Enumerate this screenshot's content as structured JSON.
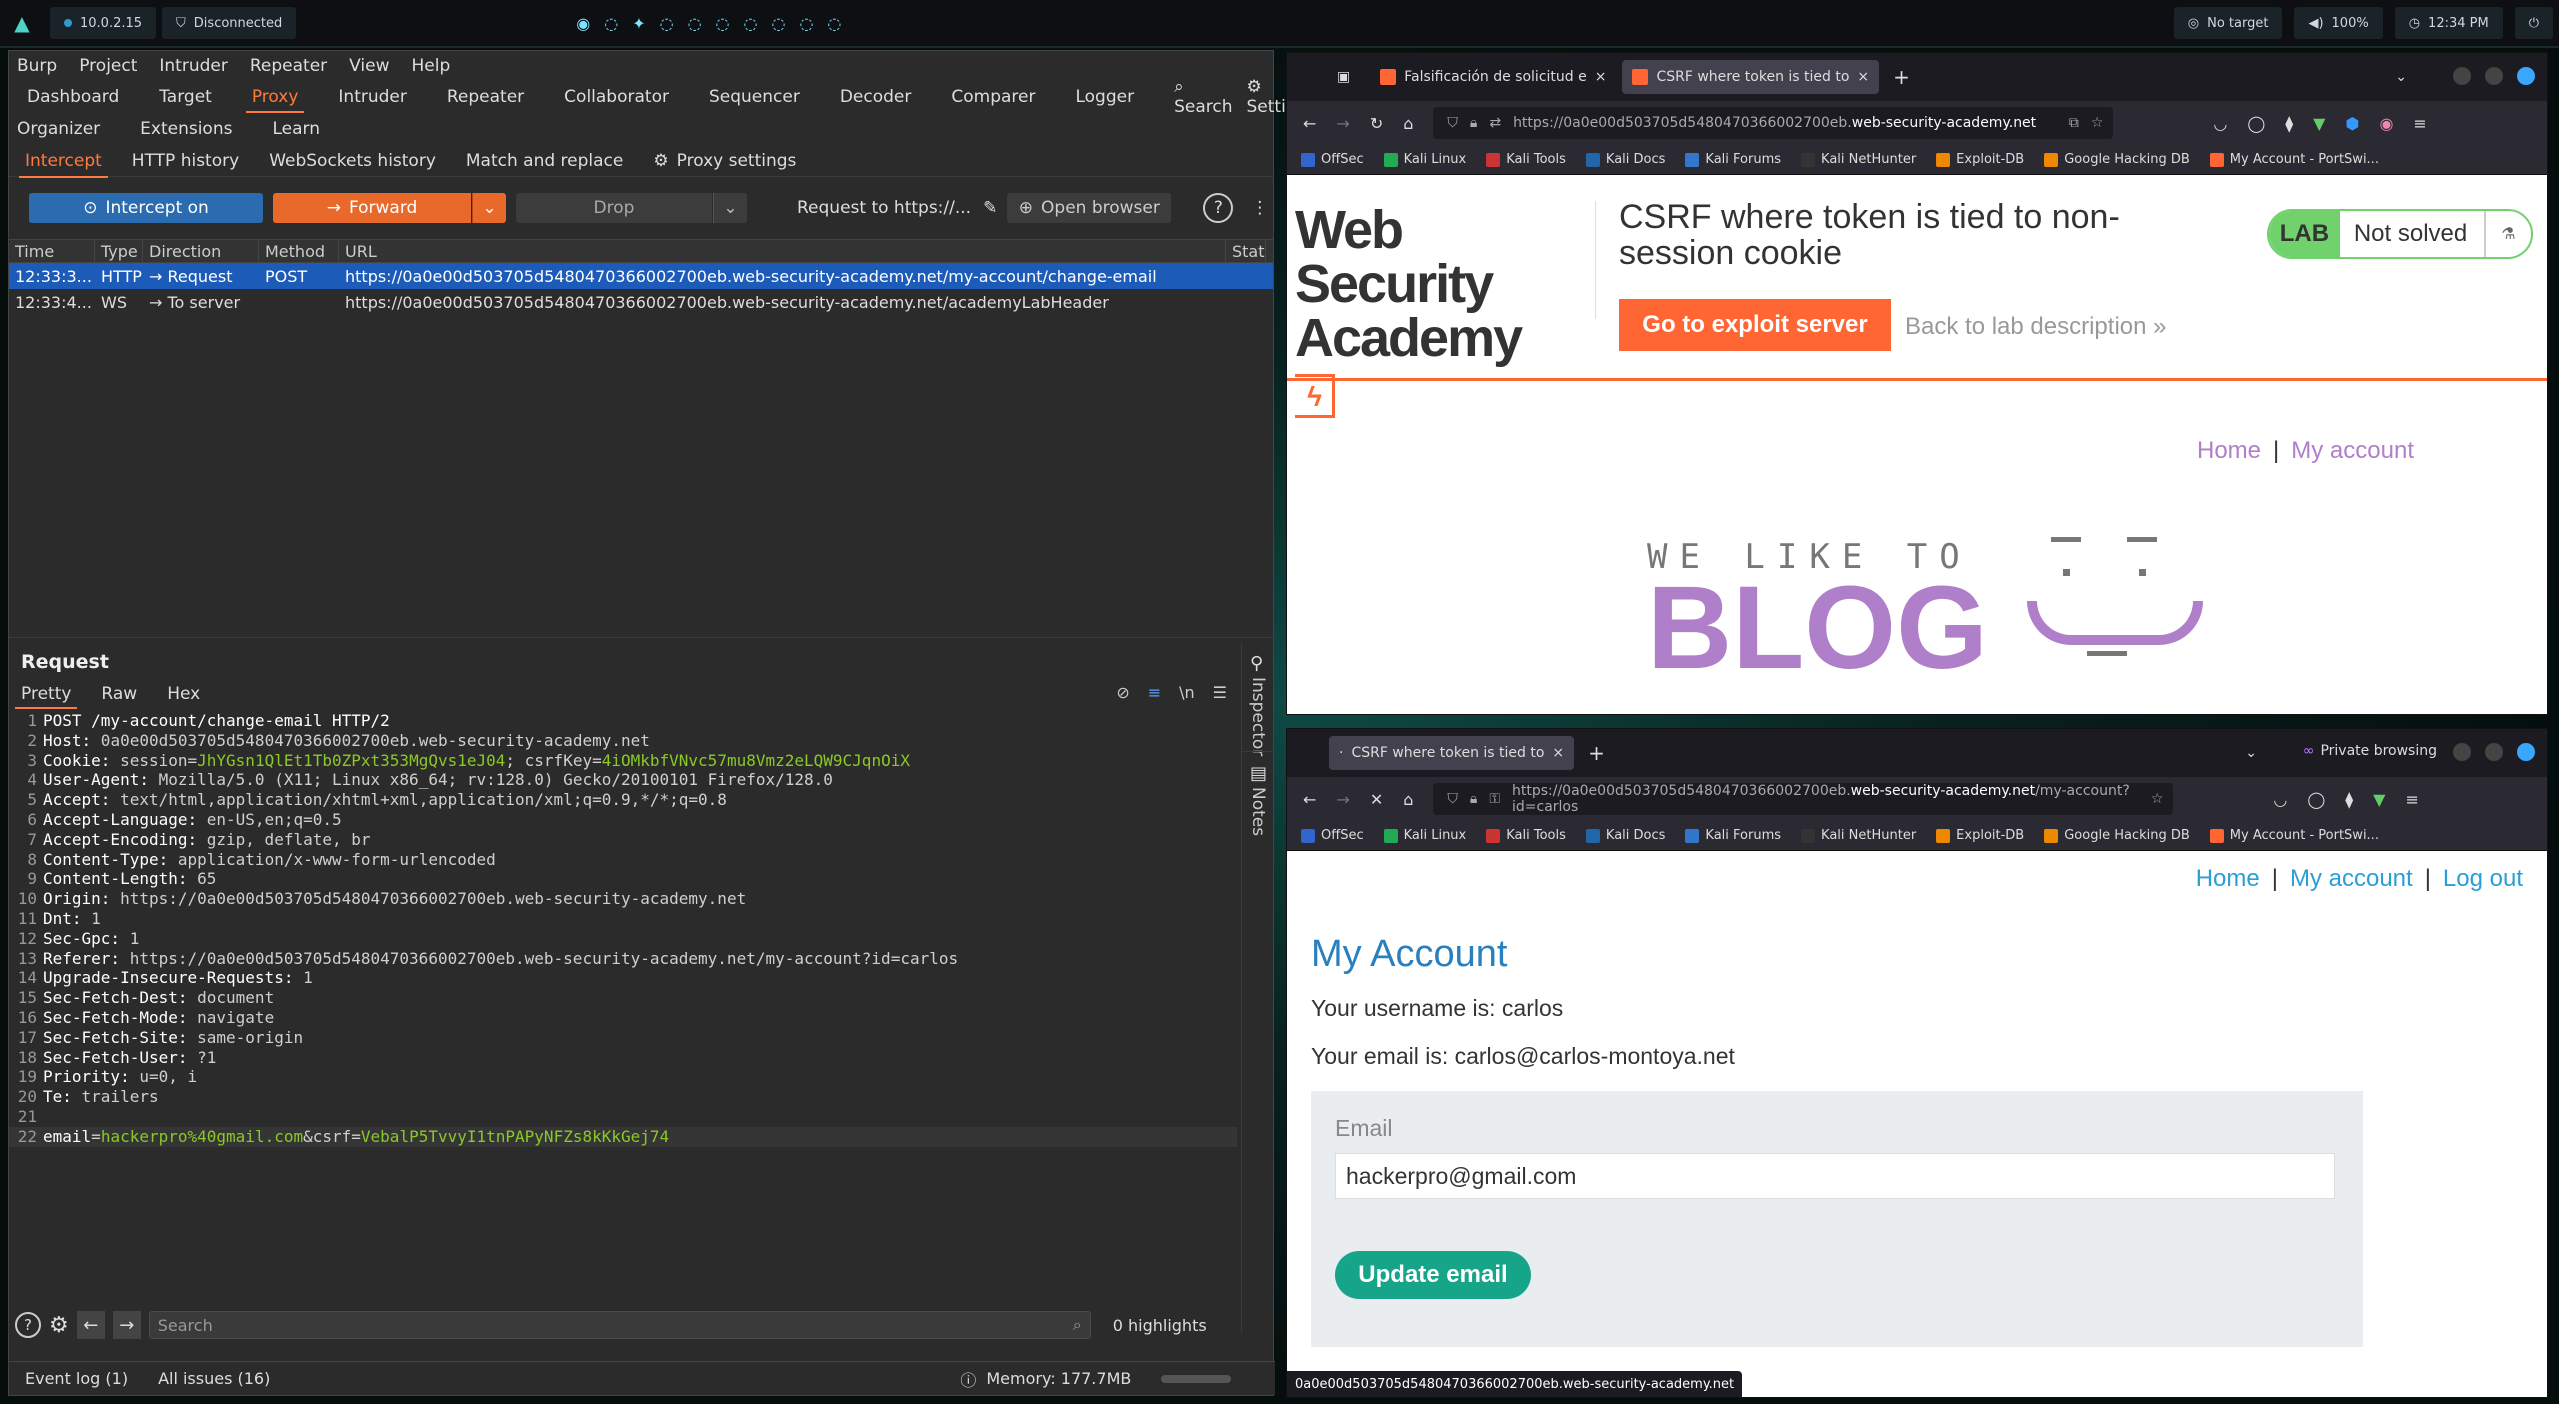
{
  "topbar": {
    "ip": "10.0.2.15",
    "vpn": "Disconnected",
    "target": "No target",
    "volume": "100%",
    "clock": "12:34 PM"
  },
  "burp": {
    "menu": [
      "Burp",
      "Project",
      "Intruder",
      "Repeater",
      "View",
      "Help"
    ],
    "tabs_row1": [
      "Dashboard",
      "Target",
      "Proxy",
      "Intruder",
      "Repeater",
      "Collaborator",
      "Sequencer",
      "Decoder",
      "Comparer",
      "Logger"
    ],
    "search_label": "Search",
    "settings_label": "Settings",
    "tabs_row2": [
      "Organizer",
      "Extensions",
      "Learn"
    ],
    "subtabs": [
      "Intercept",
      "HTTP history",
      "WebSockets history",
      "Match and replace"
    ],
    "proxy_settings": "Proxy settings",
    "intercept_btn": "Intercept on",
    "forward_btn": "Forward",
    "drop_btn": "Drop",
    "request_to": "Request to https://...",
    "open_browser": "Open browser",
    "columns": [
      "Time",
      "Type",
      "Direction",
      "Method",
      "URL",
      "Statu"
    ],
    "rows": [
      {
        "time": "12:33:3...",
        "type": "HTTP",
        "direction": "Request",
        "method": "POST",
        "url": "https://0a0e00d503705d5480470366002700eb.web-security-academy.net/my-account/change-email"
      },
      {
        "time": "12:33:4...",
        "type": "WS",
        "direction": "To server",
        "method": "",
        "url": "https://0a0e00d503705d5480470366002700eb.web-security-academy.net/academyLabHeader"
      }
    ],
    "request_title": "Request",
    "request_tabs": [
      "Pretty",
      "Raw",
      "Hex"
    ],
    "newline_toggle": "\\n",
    "request_lines": [
      {
        "k": "POST /my-account/change-email HTTP/2",
        "v": ""
      },
      {
        "k": "Host:",
        "v": " 0a0e00d503705d5480470366002700eb.web-security-academy.net"
      },
      {
        "k": "Cookie:",
        "v": " session=",
        "g": "JhYGsn1QlEt1Tb0ZPxt353MgQvs1eJ04",
        "v2": "; csrfKey=",
        "g2": "4iOMkbfVNvc57mu8Vmz2eLQW9CJqnOiX"
      },
      {
        "k": "User-Agent:",
        "v": " Mozilla/5.0 (X11; Linux x86_64; rv:128.0) Gecko/20100101 Firefox/128.0"
      },
      {
        "k": "Accept:",
        "v": " text/html,application/xhtml+xml,application/xml;q=0.9,*/*;q=0.8"
      },
      {
        "k": "Accept-Language:",
        "v": " en-US,en;q=0.5"
      },
      {
        "k": "Accept-Encoding:",
        "v": " gzip, deflate, br"
      },
      {
        "k": "Content-Type:",
        "v": " application/x-www-form-urlencoded"
      },
      {
        "k": "Content-Length:",
        "v": " 65"
      },
      {
        "k": "Origin:",
        "v": " https://0a0e00d503705d5480470366002700eb.web-security-academy.net"
      },
      {
        "k": "Dnt:",
        "v": " 1"
      },
      {
        "k": "Sec-Gpc:",
        "v": " 1"
      },
      {
        "k": "Referer:",
        "v": " https://0a0e00d503705d5480470366002700eb.web-security-academy.net/my-account?id=carlos"
      },
      {
        "k": "Upgrade-Insecure-Requests:",
        "v": " 1"
      },
      {
        "k": "Sec-Fetch-Dest:",
        "v": " document"
      },
      {
        "k": "Sec-Fetch-Mode:",
        "v": " navigate"
      },
      {
        "k": "Sec-Fetch-Site:",
        "v": " same-origin"
      },
      {
        "k": "Sec-Fetch-User:",
        "v": " ?1"
      },
      {
        "k": "Priority:",
        "v": " u=0, i"
      },
      {
        "k": "Te:",
        "v": " trailers"
      },
      {
        "k": "",
        "v": ""
      },
      {
        "k": "email",
        "v": "=",
        "g": "hackerpro%40gmail.com",
        "v2": "&csrf=",
        "g2": "VebalP5TvvyI1tnPAPyNFZs8kKkGej74"
      }
    ],
    "inspector_label": "Inspector",
    "notes_label": "Notes",
    "search_placeholder": "Search",
    "highlights": "0 highlights",
    "event_log": "Event log (1)",
    "all_issues": "All issues (16)",
    "memory": "Memory: 177.7MB"
  },
  "bookmarks": [
    "OffSec",
    "Kali Linux",
    "Kali Tools",
    "Kali Docs",
    "Kali Forums",
    "Kali NetHunter",
    "Exploit-DB",
    "Google Hacking DB",
    "My Account - PortSwi..."
  ],
  "browser1": {
    "tab1": "Falsificación de solicitud e",
    "tab2": "CSRF where token is tied to",
    "url_prefix": "https://0a0e00d503705d5480470366002700eb.",
    "url_domain": "web-security-academy.net",
    "logo_line1": "Web Security",
    "logo_line2": "Academy",
    "lab_title": "CSRF where token is tied to non-session cookie",
    "exploit_btn": "Go to exploit server",
    "back_link": "Back to lab description",
    "lab_badge": "LAB",
    "lab_status": "Not solved",
    "nav_home": "Home",
    "nav_account": "My account",
    "nav_sep": "|",
    "welike": "WE LIKE TO",
    "blog": "BLOG"
  },
  "browser2": {
    "tab": "CSRF where token is tied to",
    "private": "Private browsing",
    "url_prefix": "https://0a0e00d503705d5480470366002700eb.",
    "url_domain": "web-security-academy.net",
    "url_path": "/my-account?id=carlos",
    "nav_home": "Home",
    "nav_account": "My account",
    "nav_logout": "Log out",
    "nav_sep": "|",
    "title": "My Account",
    "username_line": "Your username is: carlos",
    "email_line": "Your email is: carlos@carlos-montoya.net",
    "email_label": "Email",
    "email_value": "hackerpro@gmail.com",
    "update_btn": "Update email",
    "status_url": "0a0e00d503705d5480470366002700eb.web-security-academy.net"
  }
}
